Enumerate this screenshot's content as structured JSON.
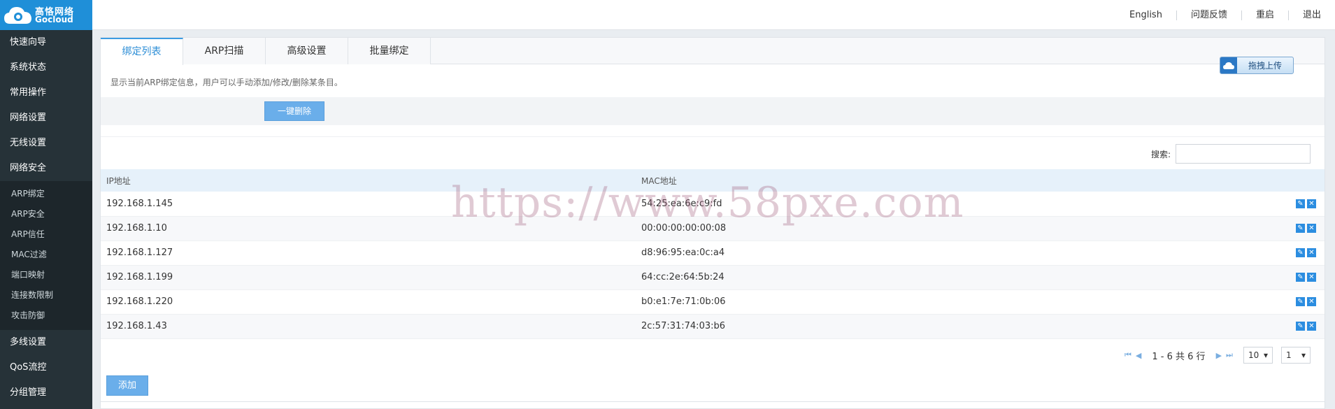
{
  "brand": {
    "name_cn": "高恪网络",
    "name_en": "Gocloud"
  },
  "topnav": [
    "English",
    "问题反馈",
    "重启",
    "退出"
  ],
  "sidebar": {
    "items_top": [
      "快速向导",
      "系统状态",
      "常用操作",
      "网络设置",
      "无线设置",
      "网络安全"
    ],
    "sub_items": [
      "ARP绑定",
      "ARP安全",
      "ARP信任",
      "MAC过滤",
      "端口映射",
      "连接数限制",
      "攻击防御"
    ],
    "items_bottom": [
      "多线设置",
      "QoS流控",
      "分组管理"
    ]
  },
  "tabs": [
    {
      "label": "绑定列表",
      "active": true
    },
    {
      "label": "ARP扫描",
      "active": false
    },
    {
      "label": "高级设置",
      "active": false
    },
    {
      "label": "批量绑定",
      "active": false
    }
  ],
  "upload_label": "拖拽上传",
  "description": "显示当前ARP绑定信息，用户可以手动添加/修改/删除某条目。",
  "bulk_delete_label": "一键删除",
  "search": {
    "label": "搜索:",
    "value": ""
  },
  "table": {
    "headers": [
      "IP地址",
      "MAC地址"
    ],
    "rows": [
      [
        "192.168.1.145",
        "54:25:ea:6e:c9:fd"
      ],
      [
        "192.168.1.10",
        "00:00:00:00:00:08"
      ],
      [
        "192.168.1.127",
        "d8:96:95:ea:0c:a4"
      ],
      [
        "192.168.1.199",
        "64:cc:2e:64:5b:24"
      ],
      [
        "192.168.1.220",
        "b0:e1:7e:71:0b:06"
      ],
      [
        "192.168.1.43",
        "2c:57:31:74:03:b6"
      ]
    ]
  },
  "pager": {
    "text": "1 - 6 共 6 行",
    "page_size": "10",
    "page": "1"
  },
  "add_label": "添加",
  "watermark": "https://www.58pxe.com",
  "colors": {
    "accent": "#2d8ed6",
    "sidebar": "#263238",
    "button": "#6aaeea",
    "logo_bg": "#1f8fd8"
  },
  "icons": {
    "edit": "pencil-icon",
    "delete": "close-icon"
  }
}
